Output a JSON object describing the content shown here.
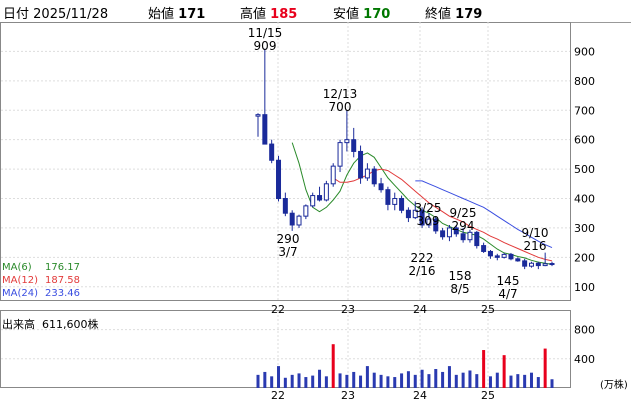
{
  "header": {
    "date_label": "日付",
    "date_value": "2025/11/28",
    "open_label": "始値",
    "open_value": "171",
    "high_label": "高値",
    "high_value": "185",
    "low_label": "安値",
    "low_value": "170",
    "close_label": "終値",
    "close_value": "179",
    "colors": {
      "high": "#e8001c",
      "low": "#007700",
      "close": "#000000"
    }
  },
  "ma_legend": [
    {
      "label": "MA(6)",
      "value": "176.17",
      "color": "#2a8a2a"
    },
    {
      "label": "MA(12)",
      "value": "187.58",
      "color": "#e23a3a"
    },
    {
      "label": "MA(24)",
      "value": "233.46",
      "color": "#3a4ee0"
    }
  ],
  "volume_legend": {
    "label": "出来高",
    "value": "611,600株"
  },
  "volume_unit": "(万株)",
  "chart_data": {
    "type": "candlestick",
    "y_ticks": [
      100,
      200,
      300,
      400,
      500,
      600,
      700,
      800,
      900
    ],
    "ylim": [
      55,
      1000
    ],
    "x_ticks": [
      "22",
      "23",
      "24",
      "25"
    ],
    "volume_ticks": [
      400,
      800
    ],
    "annotations": [
      {
        "date": "11/15",
        "value": "909"
      },
      {
        "date": "12/13",
        "value": "700"
      },
      {
        "date": "3/7",
        "value": "290"
      },
      {
        "date": "3/25",
        "value": "309"
      },
      {
        "date": "9/25",
        "value": "294"
      },
      {
        "date": "2/16",
        "value": "222"
      },
      {
        "date": "8/5",
        "value": "158"
      },
      {
        "date": "4/7",
        "value": "145"
      },
      {
        "date": "9/10",
        "value": "216"
      }
    ],
    "candles": [
      [
        680,
        690,
        610,
        685
      ],
      [
        685,
        909,
        600,
        585
      ],
      [
        585,
        600,
        520,
        530
      ],
      [
        530,
        545,
        390,
        400
      ],
      [
        400,
        420,
        340,
        350
      ],
      [
        350,
        360,
        290,
        310
      ],
      [
        310,
        345,
        300,
        340
      ],
      [
        340,
        380,
        330,
        375
      ],
      [
        375,
        420,
        370,
        410
      ],
      [
        410,
        440,
        390,
        395
      ],
      [
        395,
        460,
        390,
        450
      ],
      [
        450,
        520,
        440,
        510
      ],
      [
        510,
        600,
        490,
        590
      ],
      [
        590,
        700,
        560,
        600
      ],
      [
        600,
        640,
        540,
        560
      ],
      [
        560,
        580,
        450,
        470
      ],
      [
        470,
        520,
        460,
        500
      ],
      [
        500,
        510,
        440,
        450
      ],
      [
        450,
        470,
        420,
        430
      ],
      [
        430,
        440,
        360,
        380
      ],
      [
        380,
        420,
        360,
        400
      ],
      [
        400,
        410,
        350,
        360
      ],
      [
        360,
        370,
        320,
        335
      ],
      [
        335,
        390,
        330,
        360
      ],
      [
        360,
        370,
        300,
        310
      ],
      [
        310,
        350,
        300,
        330
      ],
      [
        330,
        340,
        280,
        290
      ],
      [
        290,
        300,
        260,
        270
      ],
      [
        270,
        310,
        255,
        300
      ],
      [
        300,
        309,
        270,
        280
      ],
      [
        280,
        300,
        250,
        260
      ],
      [
        260,
        294,
        250,
        285
      ],
      [
        285,
        290,
        230,
        240
      ],
      [
        240,
        250,
        215,
        220
      ],
      [
        220,
        225,
        195,
        205
      ],
      [
        205,
        212,
        190,
        200
      ],
      [
        200,
        215,
        196,
        210
      ],
      [
        210,
        215,
        190,
        195
      ],
      [
        195,
        200,
        185,
        188
      ],
      [
        188,
        195,
        160,
        170
      ],
      [
        170,
        185,
        165,
        180
      ],
      [
        180,
        185,
        160,
        172
      ],
      [
        172,
        216,
        170,
        178
      ],
      [
        178,
        185,
        170,
        179
      ]
    ],
    "ma": {
      "MA(6)": [
        null,
        null,
        null,
        null,
        null,
        590,
        520,
        430,
        370,
        355,
        370,
        395,
        425,
        480,
        520,
        545,
        555,
        540,
        505,
        470,
        445,
        420,
        395,
        375,
        360,
        350,
        335,
        315,
        305,
        295,
        285,
        280,
        275,
        262,
        245,
        228,
        215,
        210,
        203,
        198,
        190,
        184,
        180,
        176
      ],
      "MA(12)": [
        null,
        null,
        null,
        null,
        null,
        null,
        null,
        null,
        null,
        null,
        null,
        470,
        455,
        455,
        460,
        470,
        480,
        495,
        500,
        495,
        480,
        465,
        445,
        425,
        405,
        385,
        370,
        355,
        340,
        330,
        320,
        305,
        295,
        285,
        272,
        262,
        250,
        240,
        230,
        220,
        210,
        200,
        193,
        188
      ],
      "MA(24)": [
        null,
        null,
        null,
        null,
        null,
        null,
        null,
        null,
        null,
        null,
        null,
        null,
        null,
        null,
        null,
        null,
        null,
        null,
        null,
        null,
        null,
        null,
        null,
        460,
        460,
        450,
        440,
        430,
        420,
        410,
        400,
        390,
        380,
        370,
        355,
        340,
        325,
        310,
        295,
        282,
        268,
        255,
        243,
        233
      ]
    },
    "volume": [
      180,
      220,
      160,
      300,
      140,
      180,
      200,
      150,
      170,
      250,
      160,
      600,
      200,
      180,
      220,
      170,
      300,
      210,
      180,
      160,
      150,
      200,
      230,
      180,
      250,
      190,
      260,
      220,
      300,
      180,
      210,
      240,
      190,
      520,
      160,
      210,
      450,
      170,
      190,
      180,
      210,
      150,
      540,
      120
    ]
  }
}
